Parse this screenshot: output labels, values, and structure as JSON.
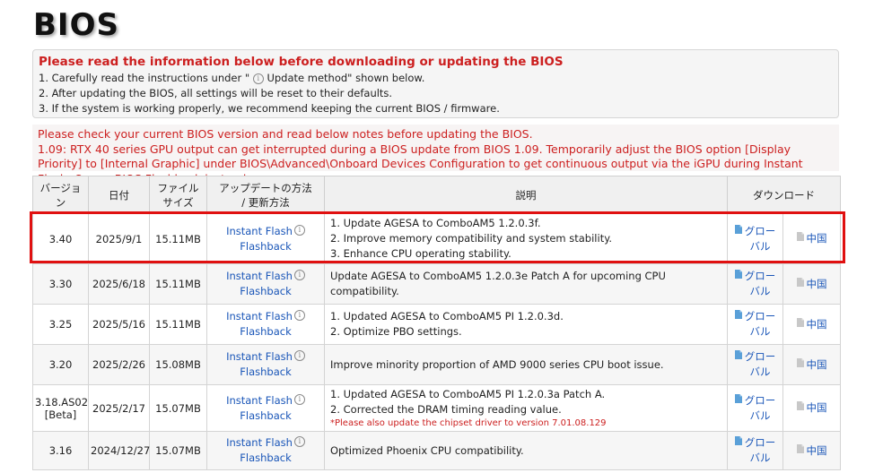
{
  "page": {
    "title": "BIOS"
  },
  "notice": {
    "heading": "Please read the information below before downloading or updating the BIOS",
    "line1_a": "1. Carefully read the instructions under \" ",
    "line1_b": " Update method\" shown below.",
    "line2": "2. After updating the BIOS, all settings will be reset to their defaults.",
    "line3": "3. If the system is working properly, we recommend keeping the current BIOS / firmware."
  },
  "warning": {
    "line1": "Please check your current BIOS version and read below notes before updating the BIOS.",
    "line2": "1.09: RTX 40 series GPU output can get interrupted during a BIOS update from BIOS 1.09. Temporarily adjust the BIOS option [Display Priority] to [Internal Graphic] under BIOS\\Advanced\\Onboard Devices Configuration to get continuous output via the iGPU during Instant Flash. Or use BIOS Flashback instead."
  },
  "table": {
    "headers": {
      "version": "バージョン",
      "date": "日付",
      "size_1": "ファイル",
      "size_2": "サイズ",
      "method_1": "アップデートの方法",
      "method_2": "/ 更新方法",
      "description": "説明",
      "download": "ダウンロード"
    },
    "info_glyph": "i",
    "rows": [
      {
        "version": "3.40",
        "version_sub": "",
        "date": "2025/9/1",
        "size": "15.11MB",
        "method1": "Instant Flash",
        "method2": "Flashback",
        "desc": [
          "1. Update AGESA to ComboAM5 1.2.0.3f.",
          "2. Improve memory compatibility and system stability.",
          "3. Enhance CPU operating stability."
        ],
        "note": "",
        "dl_global_1": "グロー",
        "dl_global_2": "バル",
        "dl_china": "中国"
      },
      {
        "version": "3.30",
        "version_sub": "",
        "date": "2025/6/18",
        "size": "15.11MB",
        "method1": "Instant Flash",
        "method2": "Flashback",
        "desc": [
          "Update AGESA to ComboAM5 1.2.0.3e Patch A for upcoming CPU compatibility."
        ],
        "note": "",
        "dl_global_1": "グロー",
        "dl_global_2": "バル",
        "dl_china": "中国"
      },
      {
        "version": "3.25",
        "version_sub": "",
        "date": "2025/5/16",
        "size": "15.11MB",
        "method1": "Instant Flash",
        "method2": "Flashback",
        "desc": [
          "1. Updated AGESA to ComboAM5 PI 1.2.0.3d.",
          "2. Optimize PBO settings."
        ],
        "note": "",
        "dl_global_1": "グロー",
        "dl_global_2": "バル",
        "dl_china": "中国"
      },
      {
        "version": "3.20",
        "version_sub": "",
        "date": "2025/2/26",
        "size": "15.08MB",
        "method1": "Instant Flash",
        "method2": "Flashback",
        "desc": [
          "Improve minority proportion of AMD 9000 series CPU boot issue."
        ],
        "note": "",
        "dl_global_1": "グロー",
        "dl_global_2": "バル",
        "dl_china": "中国"
      },
      {
        "version": "3.18.AS02",
        "version_sub": "[Beta]",
        "date": "2025/2/17",
        "size": "15.07MB",
        "method1": "Instant Flash",
        "method2": "Flashback",
        "desc": [
          "1. Updated AGESA to ComboAM5 PI 1.2.0.3a Patch A.",
          "2. Corrected the DRAM timing reading value."
        ],
        "note": "*Please also update the chipset driver to version 7.01.08.129",
        "dl_global_1": "グロー",
        "dl_global_2": "バル",
        "dl_china": "中国"
      },
      {
        "version": "3.16",
        "version_sub": "",
        "date": "2024/12/27",
        "size": "15.07MB",
        "method1": "Instant Flash",
        "method2": "Flashback",
        "desc": [
          "Optimized Phoenix CPU compatibility."
        ],
        "note": "",
        "dl_global_1": "グロー",
        "dl_global_2": "バル",
        "dl_china": "中国"
      }
    ]
  },
  "colors": {
    "accent_red": "#cc1f1f",
    "link_blue": "#1a56b8",
    "highlight_red": "#e01010"
  }
}
